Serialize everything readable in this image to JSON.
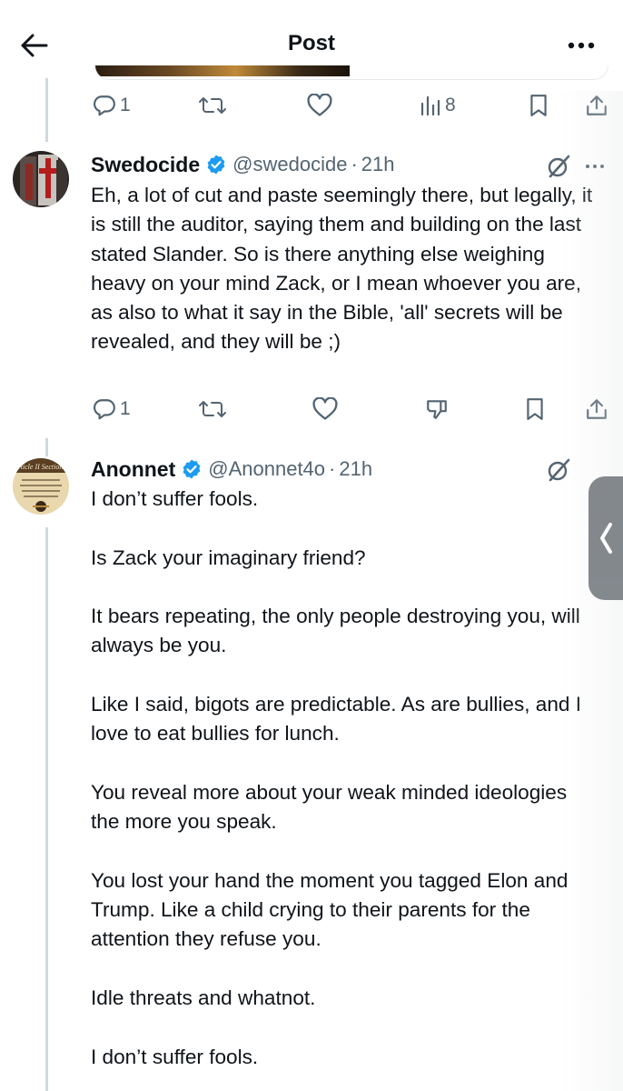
{
  "header": {
    "title": "Post"
  },
  "top_actions": {
    "reply_count": "1",
    "views_count": "8"
  },
  "replies": [
    {
      "name": "Swedocide",
      "handle": "@swedocide",
      "time": "21h",
      "text": [
        "Eh, a lot of cut and paste seemingly there, but legally, it is still the auditor, saying them and building on the last stated Slander. So is there anything else weighing heavy on your mind Zack, or I mean whoever you are, as also to what it say in the Bible, 'all' secrets will be revealed, and they will be ;)"
      ],
      "reply_count": "1"
    },
    {
      "name": "Anonnet",
      "handle": "@Anonnet4o",
      "time": "21h",
      "text": [
        "I don’t suffer fools.",
        "Is Zack your imaginary friend?",
        "It bears repeating, the only people destroying you, will always be you.",
        "Like I said, bigots are predictable. As are bullies, and I love to eat bullies for lunch.",
        "You reveal more about your weak minded ideologies the more you speak.",
        "You lost your hand the moment you tagged Elon and Trump. Like a child crying to their parents for the attention they refuse you.",
        "Idle threats and whatnot.",
        "I don’t suffer fools."
      ]
    }
  ],
  "colors": {
    "verified": "#1d9bf0",
    "muted": "#536471",
    "line": "#cfd9de"
  },
  "icons": [
    "back-arrow-icon",
    "more-icon",
    "reply-icon",
    "retweet-icon",
    "like-icon",
    "views-icon",
    "bookmark-icon",
    "share-icon",
    "verified-icon",
    "grok-icon",
    "dislike-icon",
    "chevron-left-icon"
  ]
}
